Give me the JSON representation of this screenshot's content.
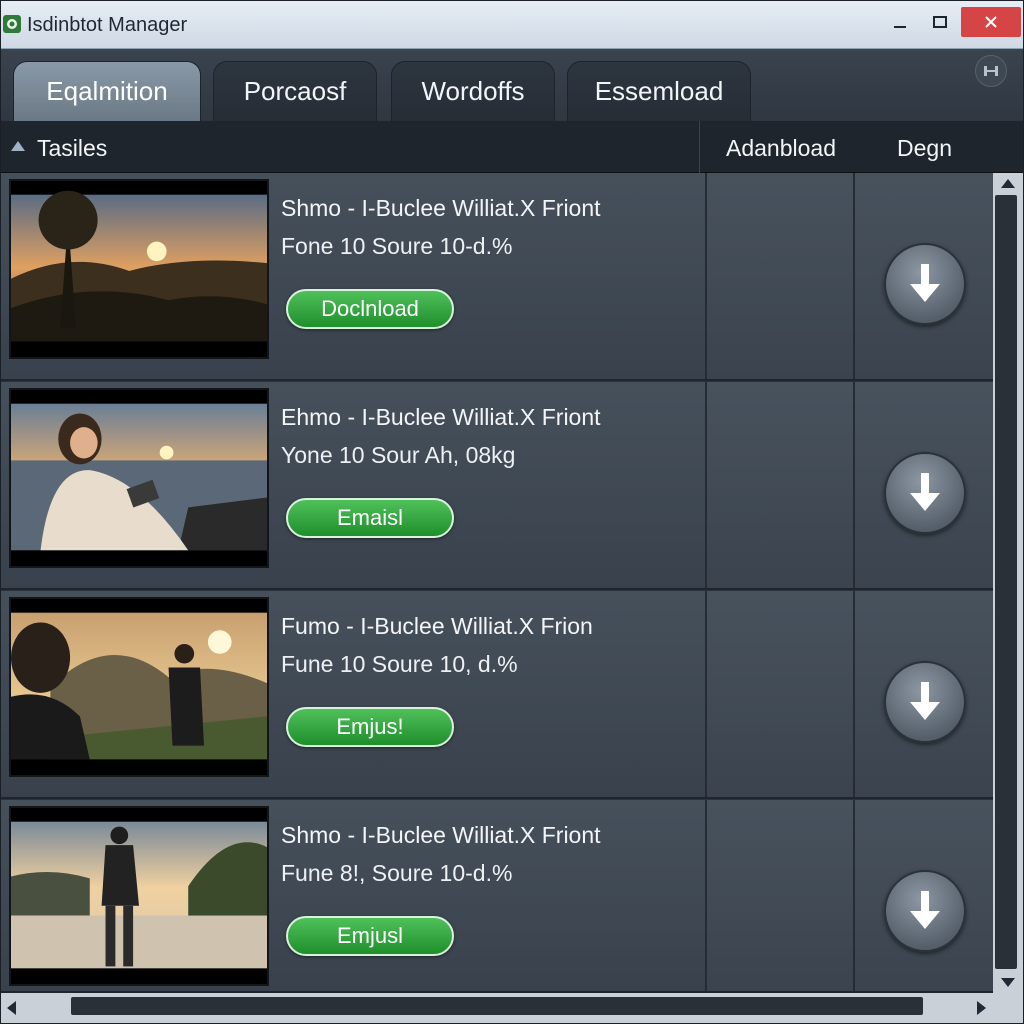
{
  "window": {
    "title": "Isdinbtot Manager",
    "app_icon": "app-logo-icon"
  },
  "tabs": [
    {
      "label": "Eqalmition",
      "active": true
    },
    {
      "label": "Porcaosf",
      "active": false
    },
    {
      "label": "Wordoffs",
      "active": false
    },
    {
      "label": "Essemload",
      "active": false
    }
  ],
  "columns": {
    "titles": "Tasiles",
    "adanbload": "Adanbload",
    "degn": "Degn"
  },
  "rows": [
    {
      "title": "Shmo - I-Buclee Williat.X Friont",
      "subtitle": "Fone 10 Soure 10-d.%",
      "button": "Doclnload",
      "thumb": "sunset-landscape"
    },
    {
      "title": "Ehmo - I-Buclee Williat.X Friont",
      "subtitle": "Yone 10 Sour Ah, 08kg",
      "button": "Emaisl",
      "thumb": "woman-laptop-beach"
    },
    {
      "title": "Fumo - I-Buclee Williat.X Frion",
      "subtitle": "Fune 10 Soure 10, d.%",
      "button": "Emjus!",
      "thumb": "two-people-mountains"
    },
    {
      "title": "Shmo - I-Buclee Williat.X Friont",
      "subtitle": "Fune 8!, Soure 10-d.%",
      "button": "Emjusl",
      "thumb": "man-beach-sunset"
    }
  ],
  "colors": {
    "accent_green": "#2aa338",
    "close_red": "#d64545",
    "background": "#2b333d"
  }
}
